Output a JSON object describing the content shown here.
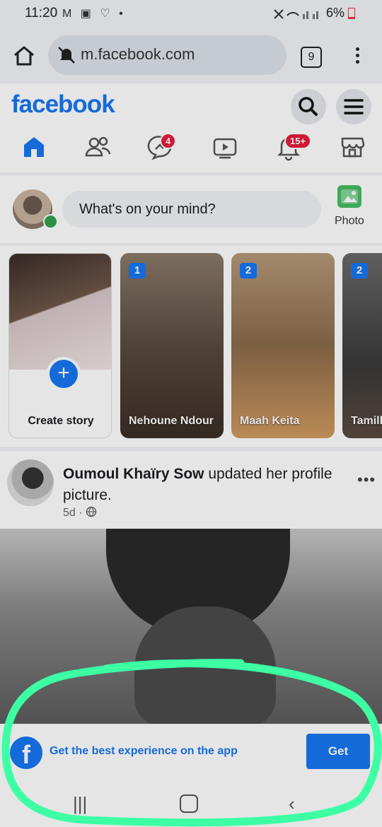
{
  "status_bar": {
    "time": "11:20",
    "left_icons": "M ▣ ♡ •",
    "battery": "6%"
  },
  "browser": {
    "url": "m.facebook.com",
    "tab_count": "9"
  },
  "header": {
    "logo": "facebook"
  },
  "nav": {
    "messages_badge": "4",
    "notifications_badge": "15+"
  },
  "composer": {
    "placeholder": "What's on your mind?",
    "photo_label": "Photo"
  },
  "stories": [
    {
      "label": "Create story"
    },
    {
      "count": "1",
      "name": "Nehoune Ndour"
    },
    {
      "count": "2",
      "name": "Maah Keita"
    },
    {
      "count": "2",
      "name": "Tamill"
    }
  ],
  "post": {
    "author": "Oumoul Khaïry Sow",
    "action": "updated her profile picture.",
    "time": "5d",
    "audience_icon": "globe-icon"
  },
  "app_banner": {
    "text": "Get the best experience on the app",
    "button": "Get"
  },
  "colors": {
    "brand": "#1877f2",
    "badge": "#e41e3f",
    "highlight": "#3dffa4"
  }
}
